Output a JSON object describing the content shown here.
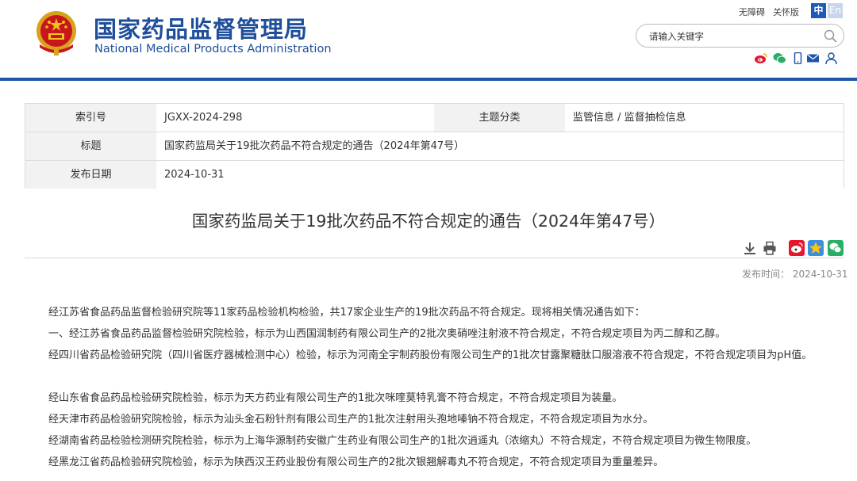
{
  "header": {
    "site_title": "国家药品监督管理局",
    "site_subtitle": "National Medical Products Administration",
    "accessibility_link": "无障碍",
    "elder_mode_link": "关怀版",
    "lang_zh": "中",
    "lang_en": "En",
    "search_placeholder": "请输入关键字",
    "social_icons": [
      "weibo-icon",
      "wechat-icon",
      "mobile-icon",
      "mail-icon",
      "user-icon"
    ]
  },
  "info": {
    "index_label": "索引号",
    "index_value": "JGXX-2024-298",
    "category_label": "主题分类",
    "category_value": "监管信息 / 监督抽检信息",
    "title_label": "标题",
    "title_value": "国家药监局关于19批次药品不符合规定的通告（2024年第47号）",
    "date_label": "发布日期",
    "date_value": "2024-10-31"
  },
  "article": {
    "title": "国家药监局关于19批次药品不符合规定的通告（2024年第47号）",
    "pubdate": "发布时间：  2024-10-31",
    "paragraphs": [
      "经江苏省食品药品监督检验研究院等11家药品检验机构检验，共17家企业生产的19批次药品不符合规定。现将相关情况通告如下：",
      "一、经江苏省食品药品监督检验研究院检验，标示为山西国润制药有限公司生产的2批次奥硝唑注射液不符合规定，不符合规定项目为丙二醇和乙醇。",
      "经四川省药品检验研究院（四川省医疗器械检测中心）检验，标示为河南全宇制药股份有限公司生产的1批次甘露聚糖肽口服溶液不符合规定，不符合规定项目为pH值。",
      "经山东省食品药品检验研究院检验，标示为天方药业有限公司生产的1批次咪喹莫特乳膏不符合规定，不符合规定项目为装量。",
      "经天津市药品检验研究院检验，标示为汕头金石粉针剂有限公司生产的1批次注射用头孢地嗪钠不符合规定，不符合规定项目为水分。",
      "经湖南省药品检验检测研究院检验，标示为上海华源制药安徽广生药业有限公司生产的1批次逍遥丸（浓缩丸）不符合规定，不符合规定项目为微生物限度。",
      "经黑龙江省药品检验研究院检验，标示为陕西汉王药业股份有限公司生产的2批次银翘解毒丸不符合规定，不符合规定项目为重量差异。"
    ]
  },
  "colors": {
    "brand_blue": "#1f4e9a",
    "header_bar": "#1f57a8",
    "lang_active": "#1d5bb5",
    "weibo_red": "#e6162d",
    "wechat_green": "#2aae67"
  }
}
